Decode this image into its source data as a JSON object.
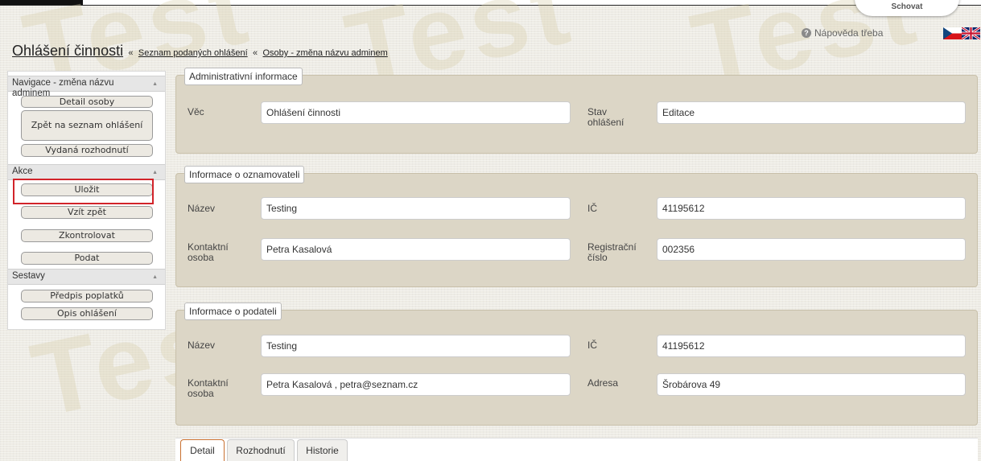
{
  "watermark_text": "Test",
  "header": {
    "hide_tab_label": "Schovat",
    "help_label": "Nápověda třeba",
    "help_icon": "question-circle-icon",
    "flags": [
      "czech-flag-icon",
      "uk-flag-icon"
    ]
  },
  "breadcrumb": {
    "title": "Ohlášení činnosti",
    "separator": "«",
    "links": [
      "Seznam podaných ohlášení",
      "Osoby - změna názvu adminem"
    ]
  },
  "sidebar": {
    "sections": [
      {
        "title": "Navigace - změna názvu adminem",
        "buttons": [
          "Detail osoby",
          "Zpět na seznam ohlášení",
          "Vydaná rozhodnutí"
        ]
      },
      {
        "title": "Akce",
        "buttons": [
          "Uložit",
          "Vzít zpět",
          "Zkontrolovat",
          "Podat"
        ]
      },
      {
        "title": "Sestavy",
        "buttons": [
          "Předpis poplatků",
          "Opis ohlášení"
        ]
      }
    ],
    "highlighted_button": "Uložit",
    "highlight_color": "#d2232a"
  },
  "admin_info": {
    "legend": "Administrativní informace",
    "vec_label": "Věc",
    "vec_value": "Ohlášení činnosti",
    "stav_label": "Stav ohlášení",
    "stav_value": "Editace"
  },
  "notifier_info": {
    "legend": "Informace o oznamovateli",
    "nazev_label": "Název",
    "nazev_value": "Testing",
    "ic_label": "IČ",
    "ic_value": "41195612",
    "contact_label": "Kontaktní osoba",
    "contact_value": "Petra Kasalová",
    "reg_label": "Registrační číslo",
    "reg_value": "002356"
  },
  "submitter_info": {
    "legend": "Informace o podateli",
    "nazev_label": "Název",
    "nazev_value": "Testing",
    "ic_label": "IČ",
    "ic_value": "41195612",
    "contact_label": "Kontaktní osoba",
    "contact_value": "Petra Kasalová , petra@seznam.cz",
    "address_label": "Adresa",
    "address_value": "Šrobárova 49"
  },
  "tabs": [
    "Detail",
    "Rozhodnutí",
    "Historie"
  ],
  "active_tab": "Detail",
  "colors": {
    "fieldset_bg": "#dcd6c6",
    "button_bg": "#ece9e2",
    "active_tab_border": "#c87030"
  }
}
